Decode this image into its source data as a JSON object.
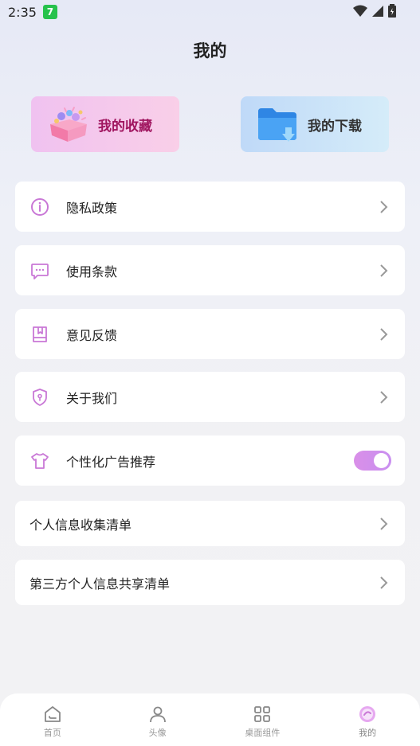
{
  "status_bar": {
    "time": "2:35",
    "app_icon_glyph": "7"
  },
  "page": {
    "title": "我的"
  },
  "quick_actions": {
    "favorites": {
      "label": "我的收藏",
      "icon": "gift-box-icon"
    },
    "downloads": {
      "label": "我的下载",
      "icon": "folder-download-icon"
    }
  },
  "menu": {
    "privacy": {
      "label": "隐私政策",
      "icon": "info-icon"
    },
    "terms": {
      "label": "使用条款",
      "icon": "chat-bubble-icon"
    },
    "feedback": {
      "label": "意见反馈",
      "icon": "notebook-icon"
    },
    "about": {
      "label": "关于我们",
      "icon": "shield-icon"
    },
    "personalized_ads": {
      "label": "个性化广告推荐",
      "icon": "tshirt-icon",
      "enabled": true
    },
    "info_collection": {
      "label": "个人信息收集清单"
    },
    "third_party_sharing": {
      "label": "第三方个人信息共享清单"
    }
  },
  "tabbar": {
    "home": {
      "label": "首页",
      "icon": "home-icon"
    },
    "avatar": {
      "label": "头像",
      "icon": "person-icon"
    },
    "widgets": {
      "label": "桌面组件",
      "icon": "grid-icon"
    },
    "mine": {
      "label": "我的",
      "icon": "profile-circle-icon",
      "active": true
    }
  },
  "colors": {
    "accent": "#d98fe8",
    "favorites_text": "#a0155f",
    "icon_stroke": "#c978d6"
  }
}
